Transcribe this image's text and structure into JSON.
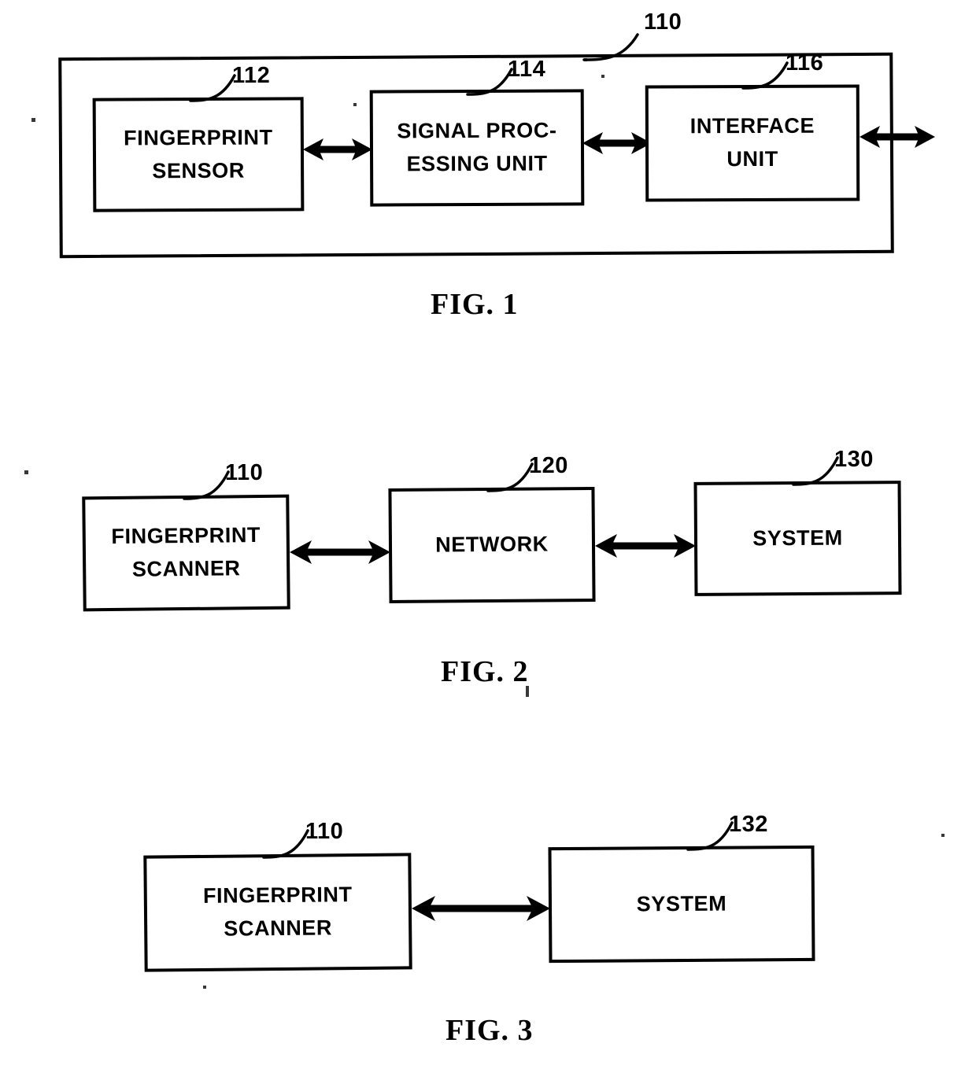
{
  "document": {
    "type": "patent-drawing-sheet",
    "figure_count": 3
  },
  "figures": [
    {
      "caption": "FIG. 1",
      "outer_ref": "110",
      "blocks": [
        {
          "ref": "112",
          "lines": [
            "FINGERPRINT",
            "SENSOR"
          ]
        },
        {
          "ref": "114",
          "lines": [
            "SIGNAL PROC-",
            "ESSING UNIT"
          ]
        },
        {
          "ref": "116",
          "lines": [
            "INTERFACE",
            "UNIT"
          ]
        }
      ],
      "connectors": [
        {
          "name": "sensor-to-spu",
          "kind": "double-arrow"
        },
        {
          "name": "spu-to-interface",
          "kind": "double-arrow"
        },
        {
          "name": "interface-to-external",
          "kind": "double-arrow"
        }
      ]
    },
    {
      "caption": "FIG. 2",
      "blocks": [
        {
          "ref": "110",
          "lines": [
            "FINGERPRINT",
            "SCANNER"
          ]
        },
        {
          "ref": "120",
          "lines": [
            "NETWORK"
          ]
        },
        {
          "ref": "130",
          "lines": [
            "SYSTEM"
          ]
        }
      ],
      "connectors": [
        {
          "name": "scanner-to-network",
          "kind": "double-arrow"
        },
        {
          "name": "network-to-system",
          "kind": "double-arrow"
        }
      ]
    },
    {
      "caption": "FIG. 3",
      "blocks": [
        {
          "ref": "110",
          "lines": [
            "FINGERPRINT",
            "SCANNER"
          ]
        },
        {
          "ref": "132",
          "lines": [
            "SYSTEM"
          ]
        }
      ],
      "connectors": [
        {
          "name": "scanner-to-system",
          "kind": "double-arrow"
        }
      ]
    }
  ],
  "colors": {
    "ink": "#000000",
    "paper": "#ffffff"
  }
}
